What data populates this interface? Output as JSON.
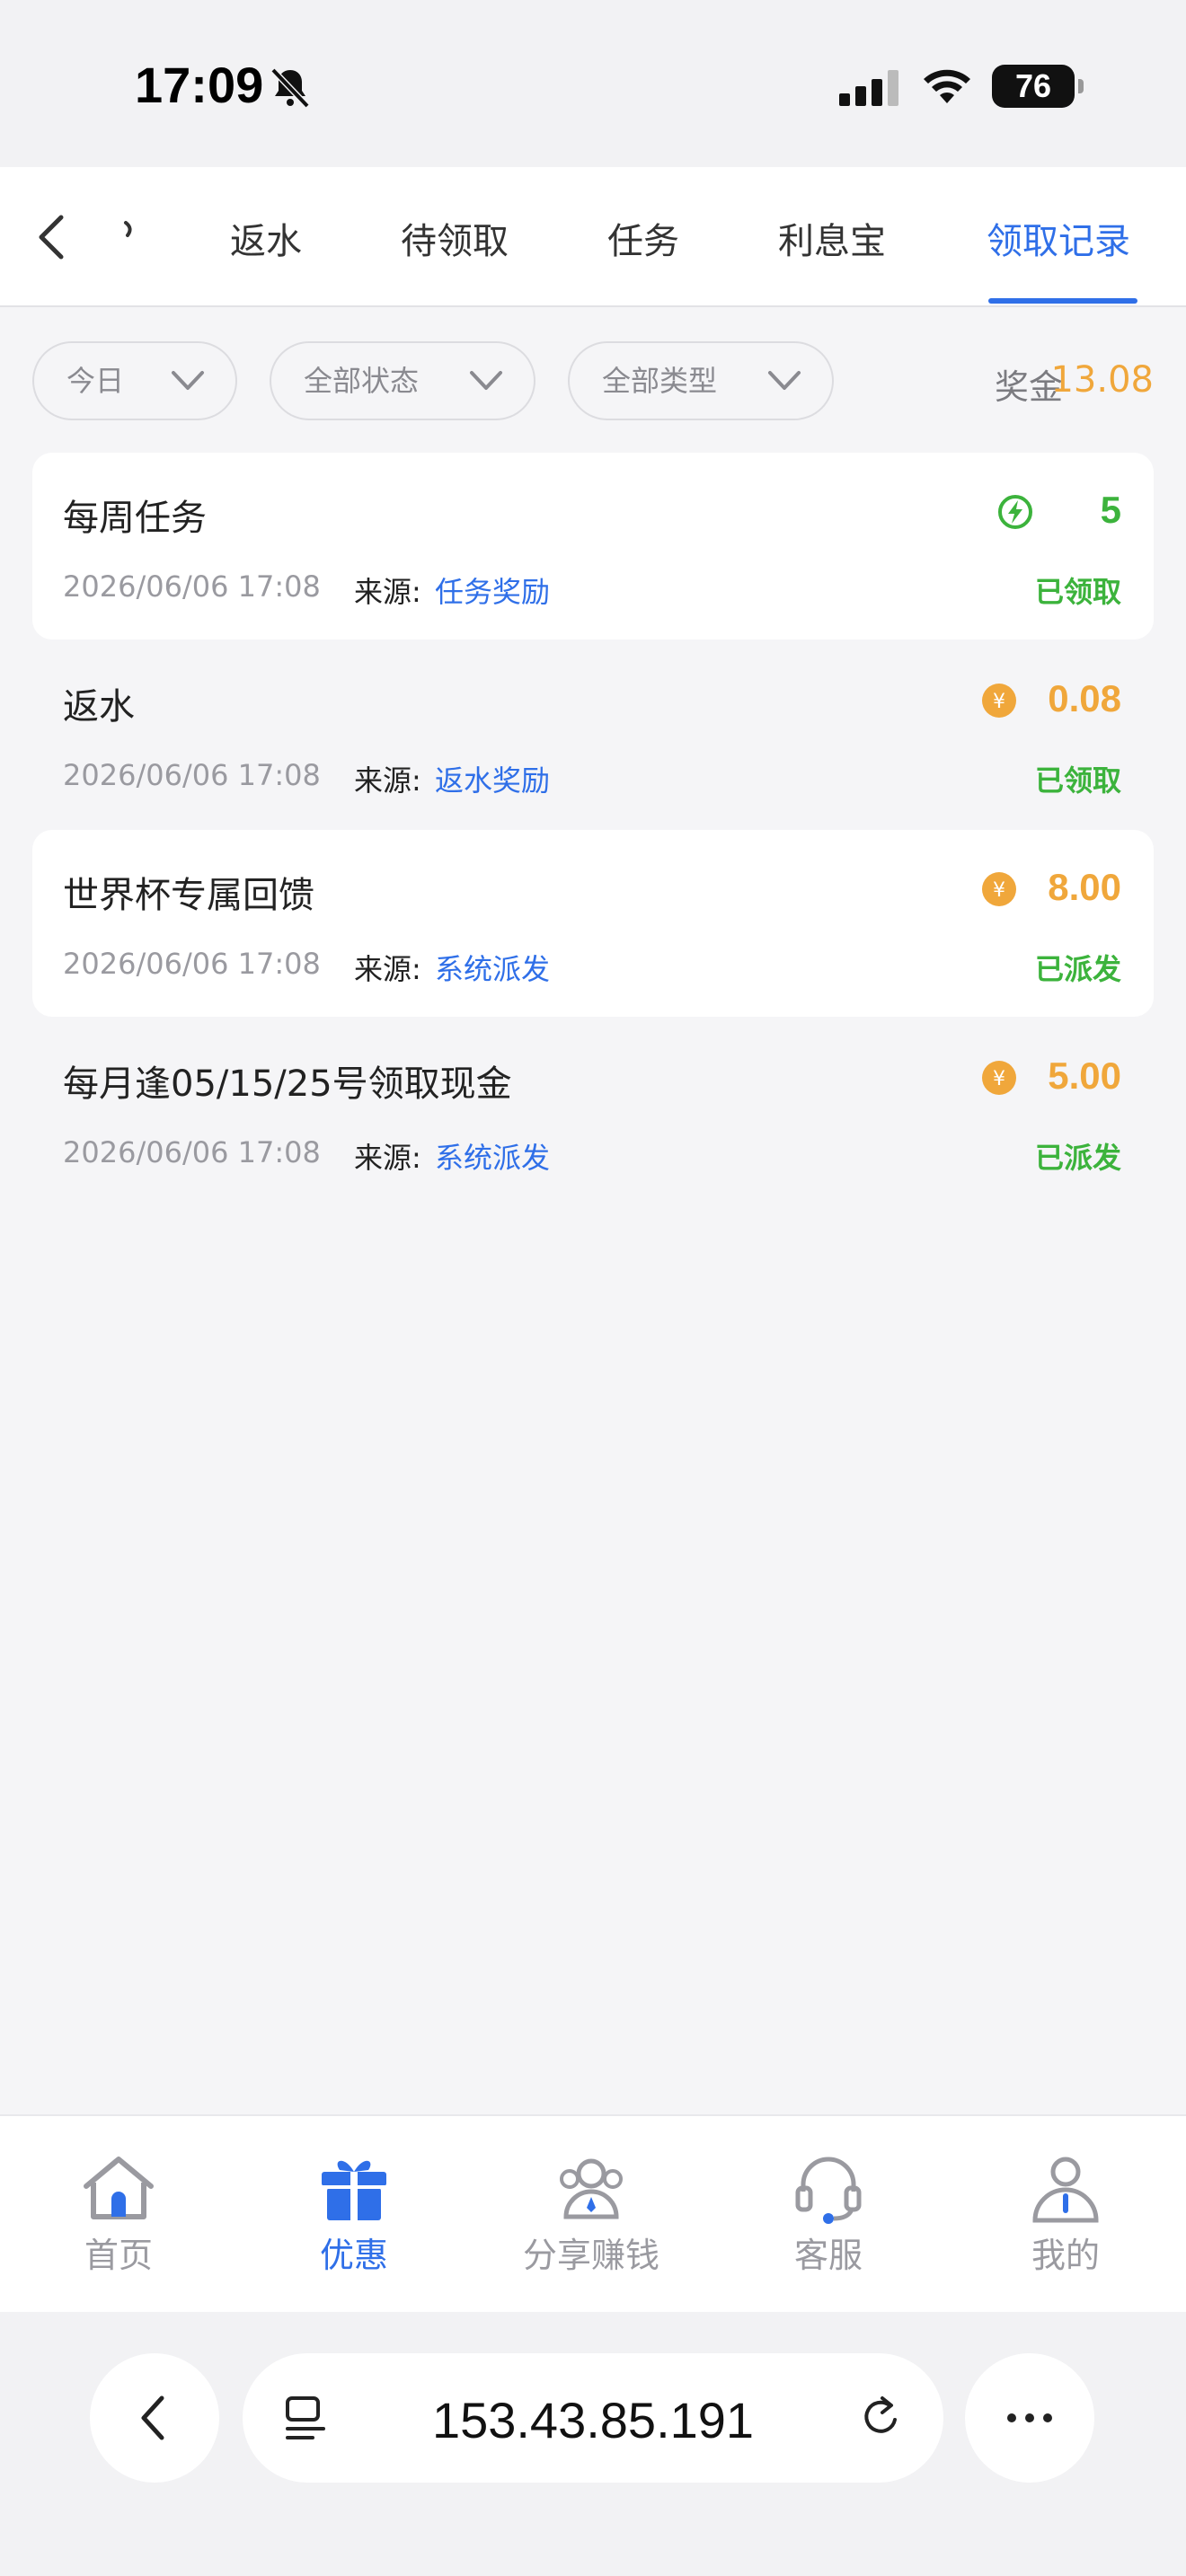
{
  "status_bar": {
    "time": "17:09",
    "battery": "76"
  },
  "tabs": {
    "items": [
      "返水",
      "待领取",
      "任务",
      "利息宝",
      "领取记录"
    ],
    "active_index": 4
  },
  "filters": {
    "date": "今日",
    "status": "全部状态",
    "type": "全部类型",
    "bonus_label": "奖金",
    "bonus_value": "13.08"
  },
  "records": [
    {
      "title": "每周任务",
      "date": "2026/06/06 17:08",
      "source_label": "来源:",
      "source": "任务奖励",
      "amount": "5",
      "amount_icon": "lightning-icon",
      "status": "已领取"
    },
    {
      "title": "返水",
      "date": "2026/06/06 17:08",
      "source_label": "来源:",
      "source": "返水奖励",
      "amount": "0.08",
      "amount_icon": "coin-icon",
      "status": "已领取"
    },
    {
      "title": "世界杯专属回馈",
      "date": "2026/06/06 17:08",
      "source_label": "来源:",
      "source": "系统派发",
      "amount": "8.00",
      "amount_icon": "coin-icon",
      "status": "已派发"
    },
    {
      "title": "每月逢05/15/25号领取现金",
      "date": "2026/06/06 17:08",
      "source_label": "来源:",
      "source": "系统派发",
      "amount": "5.00",
      "amount_icon": "coin-icon",
      "status": "已派发"
    }
  ],
  "bottom_nav": {
    "items": [
      {
        "label": "首页",
        "icon": "home-icon"
      },
      {
        "label": "优惠",
        "icon": "gift-icon"
      },
      {
        "label": "分享赚钱",
        "icon": "share-icon"
      },
      {
        "label": "客服",
        "icon": "headset-icon"
      },
      {
        "label": "我的",
        "icon": "user-icon"
      }
    ],
    "active_index": 1
  },
  "browser": {
    "url": "153.43.85.191"
  },
  "colors": {
    "accent": "#2f6fe8",
    "gold": "#f0a73b",
    "green": "#3cb33c"
  }
}
